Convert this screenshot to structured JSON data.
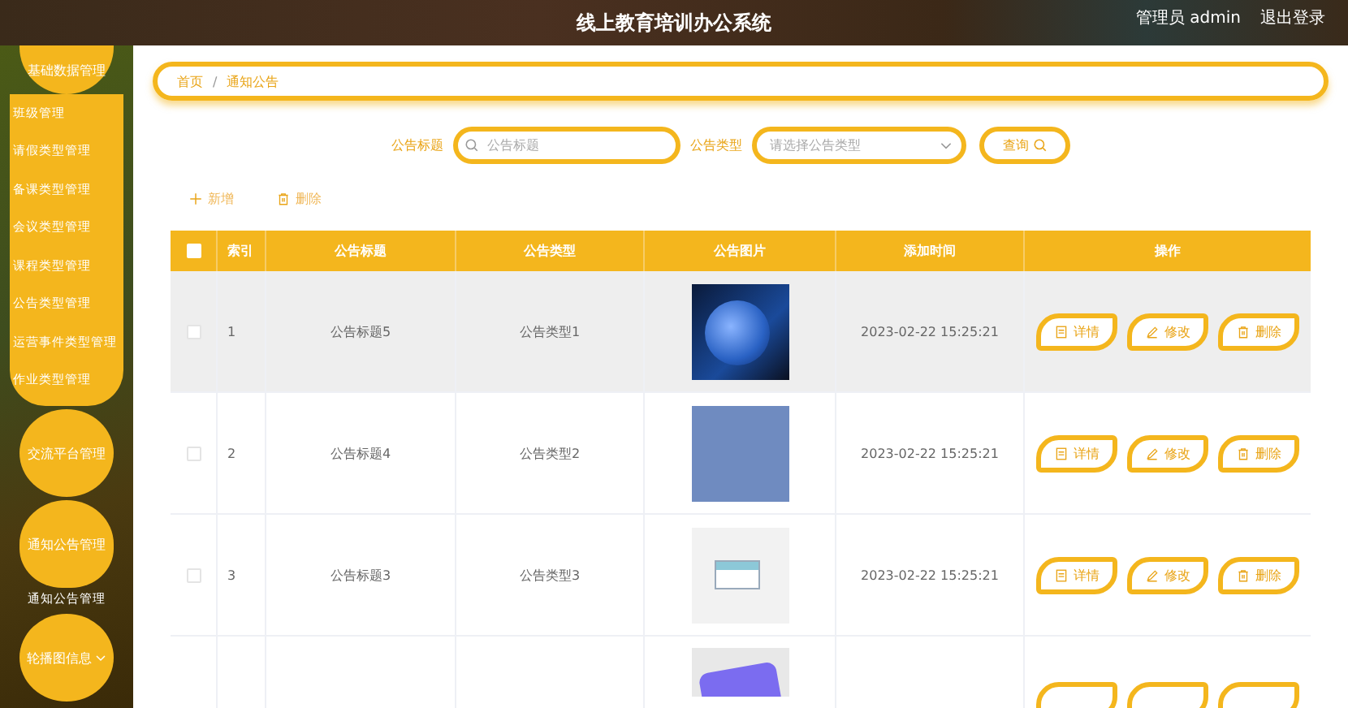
{
  "header": {
    "title": "线上教育培训办公系统",
    "user": "管理员 admin",
    "logout": "退出登录"
  },
  "sidebar": {
    "items": [
      {
        "label": "基础数据管理",
        "expanded": true,
        "children": [
          {
            "label": "班级管理"
          },
          {
            "label": "请假类型管理"
          },
          {
            "label": "备课类型管理"
          },
          {
            "label": "会议类型管理"
          },
          {
            "label": "课程类型管理"
          },
          {
            "label": "公告类型管理"
          },
          {
            "label": "运营事件类型管理"
          },
          {
            "label": "作业类型管理"
          }
        ]
      },
      {
        "label": "交流平台管理"
      },
      {
        "label": "通知公告管理",
        "expanded": true,
        "children": [
          {
            "label": "通知公告管理"
          }
        ]
      },
      {
        "label": "轮播图信息",
        "expanded": false
      }
    ]
  },
  "breadcrumb": [
    {
      "label": "首页",
      "kind": "link"
    },
    {
      "label": "/",
      "kind": "separator"
    },
    {
      "label": "通知公告",
      "kind": "link"
    }
  ],
  "search": {
    "title_label": "公告标题",
    "title_placeholder": "公告标题",
    "type_label": "公告类型",
    "type_placeholder": "请选择公告类型",
    "button": "查询"
  },
  "toolbar": [
    {
      "label": "新增",
      "kind": "add"
    },
    {
      "label": "删除",
      "kind": "delete"
    }
  ],
  "table": {
    "all_checked": false,
    "columns": [
      "索引",
      "公告标题",
      "公告类型",
      "公告图片",
      "添加时间",
      "操作"
    ],
    "rows": [
      {
        "checked": false,
        "highlighted": true,
        "index": "1",
        "title": "公告标题5",
        "type": "公告类型1",
        "image": {
          "kind": "globe"
        },
        "time": "2023-02-22 15:25:21",
        "actions": [
          {
            "label": "详情",
            "kind": "detail"
          },
          {
            "label": "修改",
            "kind": "edit"
          },
          {
            "label": "删除",
            "kind": "delete"
          }
        ]
      },
      {
        "checked": false,
        "highlighted": false,
        "index": "2",
        "title": "公告标题4",
        "type": "公告类型2",
        "image": {
          "kind": "banner"
        },
        "time": "2023-02-22 15:25:21",
        "actions": [
          {
            "label": "详情",
            "kind": "detail"
          },
          {
            "label": "修改",
            "kind": "edit"
          },
          {
            "label": "删除",
            "kind": "delete"
          }
        ]
      },
      {
        "checked": false,
        "highlighted": false,
        "index": "3",
        "title": "公告标题3",
        "type": "公告类型3",
        "image": {
          "kind": "newspaper"
        },
        "time": "2023-02-22 15:25:21",
        "actions": [
          {
            "label": "详情",
            "kind": "detail"
          },
          {
            "label": "修改",
            "kind": "edit"
          },
          {
            "label": "删除",
            "kind": "delete"
          }
        ]
      },
      {
        "highlighted": false,
        "image": {
          "kind": "sign"
        },
        "actions": [
          {
            "kind": "detail"
          },
          {
            "kind": "edit"
          },
          {
            "kind": "delete"
          }
        ]
      }
    ]
  }
}
